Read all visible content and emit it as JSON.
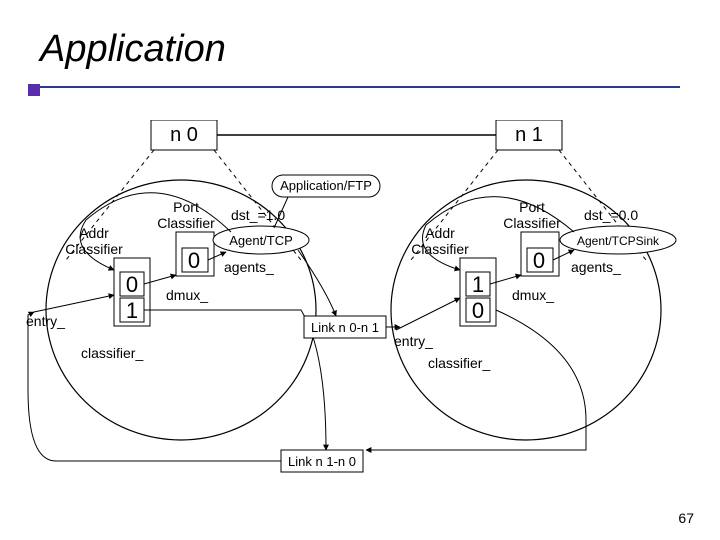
{
  "title": "Application",
  "page_number": "67",
  "nodes": {
    "left": "n 0",
    "right": "n 1"
  },
  "left": {
    "port_classifier": "Port\nClassifier",
    "addr_classifier": "Addr\nClassifier",
    "port_num": "0",
    "addr_num_top": "0",
    "addr_num_bottom": "1",
    "dmux": "dmux_",
    "entry": "entry_",
    "classifier": "classifier_",
    "agents": "agents_",
    "dst": "dst_=1.0",
    "agent": "Agent/TCP",
    "app": "Application/FTP"
  },
  "right": {
    "port_classifier": "Port\nClassifier",
    "addr_classifier": "Addr\nClassifier",
    "port_num": "0",
    "addr_num_top": "1",
    "addr_num_bottom": "0",
    "dmux": "dmux_",
    "entry": "entry_",
    "classifier": "classifier_",
    "agents": "agents_",
    "dst": "dst_=0.0",
    "agent": "Agent/TCPSink"
  },
  "links": {
    "forward": "Link n 0-n 1",
    "reverse": "Link n 1-n 0"
  }
}
